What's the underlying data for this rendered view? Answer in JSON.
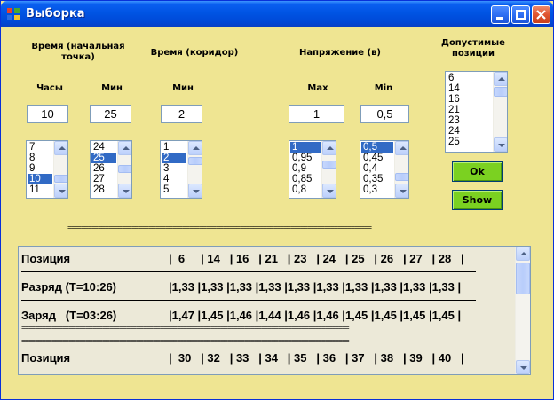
{
  "window": {
    "title": "Выборка",
    "buttons": [
      "minimize",
      "maximize",
      "close"
    ]
  },
  "headers": {
    "start_time": "Время (начальная точка)",
    "corridor_time": "Время (коридор)",
    "voltage": "Напряжение (в)",
    "allowed_positions": "Допустимые позиции",
    "hours": "Часы",
    "min1": "Мин",
    "min2": "Мин",
    "max": "Max",
    "min_v": "Min"
  },
  "inputs": {
    "hours": "10",
    "minutes": "25",
    "corridor_minutes": "2",
    "max_voltage": "1",
    "min_voltage": "0,5"
  },
  "lists": {
    "hours": {
      "items": [
        "7",
        "8",
        "9",
        "10",
        "11"
      ],
      "selected": "10"
    },
    "minutes": {
      "items": [
        "24",
        "25",
        "26",
        "27",
        "28"
      ],
      "selected": "25"
    },
    "corridor": {
      "items": [
        "1",
        "2",
        "3",
        "4",
        "5"
      ],
      "selected": "2"
    },
    "max_voltage": {
      "items": [
        "1",
        "0,95",
        "0,9",
        "0,85",
        "0,8"
      ],
      "selected": "1"
    },
    "min_voltage": {
      "items": [
        "0,5",
        "0,45",
        "0,4",
        "0,35",
        "0,3"
      ],
      "selected": "0,5"
    },
    "positions": {
      "items": [
        "6",
        "14",
        "16",
        "21",
        "23",
        "24",
        "25"
      ]
    }
  },
  "buttons": {
    "ok": "Ok",
    "show": "Show"
  },
  "separator": "==========================================================================================",
  "report": {
    "row1_label": "Позиция",
    "row1_values": "|  6     | 14   | 16   | 21   | 23   | 24   | 25   | 26   | 27   | 28   |",
    "row2_label": "Разряд (T=10:26)",
    "row2_values": "|1,33 |1,33 |1,33 |1,33 |1,33 |1,33 |1,33 |1,33 |1,33 |1,33 |",
    "row3_label": "Заряд   (T=03:26)",
    "row3_values": "|1,47 |1,45 |1,46 |1,44 |1,46 |1,46 |1,45 |1,45 |1,45 |1,45 |",
    "eq_line": "=================================================================================================",
    "row4_label": "Позиция",
    "row4_values": "|  30   | 32   | 33   | 34   | 35   | 36   | 37   | 38   | 39   | 40   |"
  }
}
